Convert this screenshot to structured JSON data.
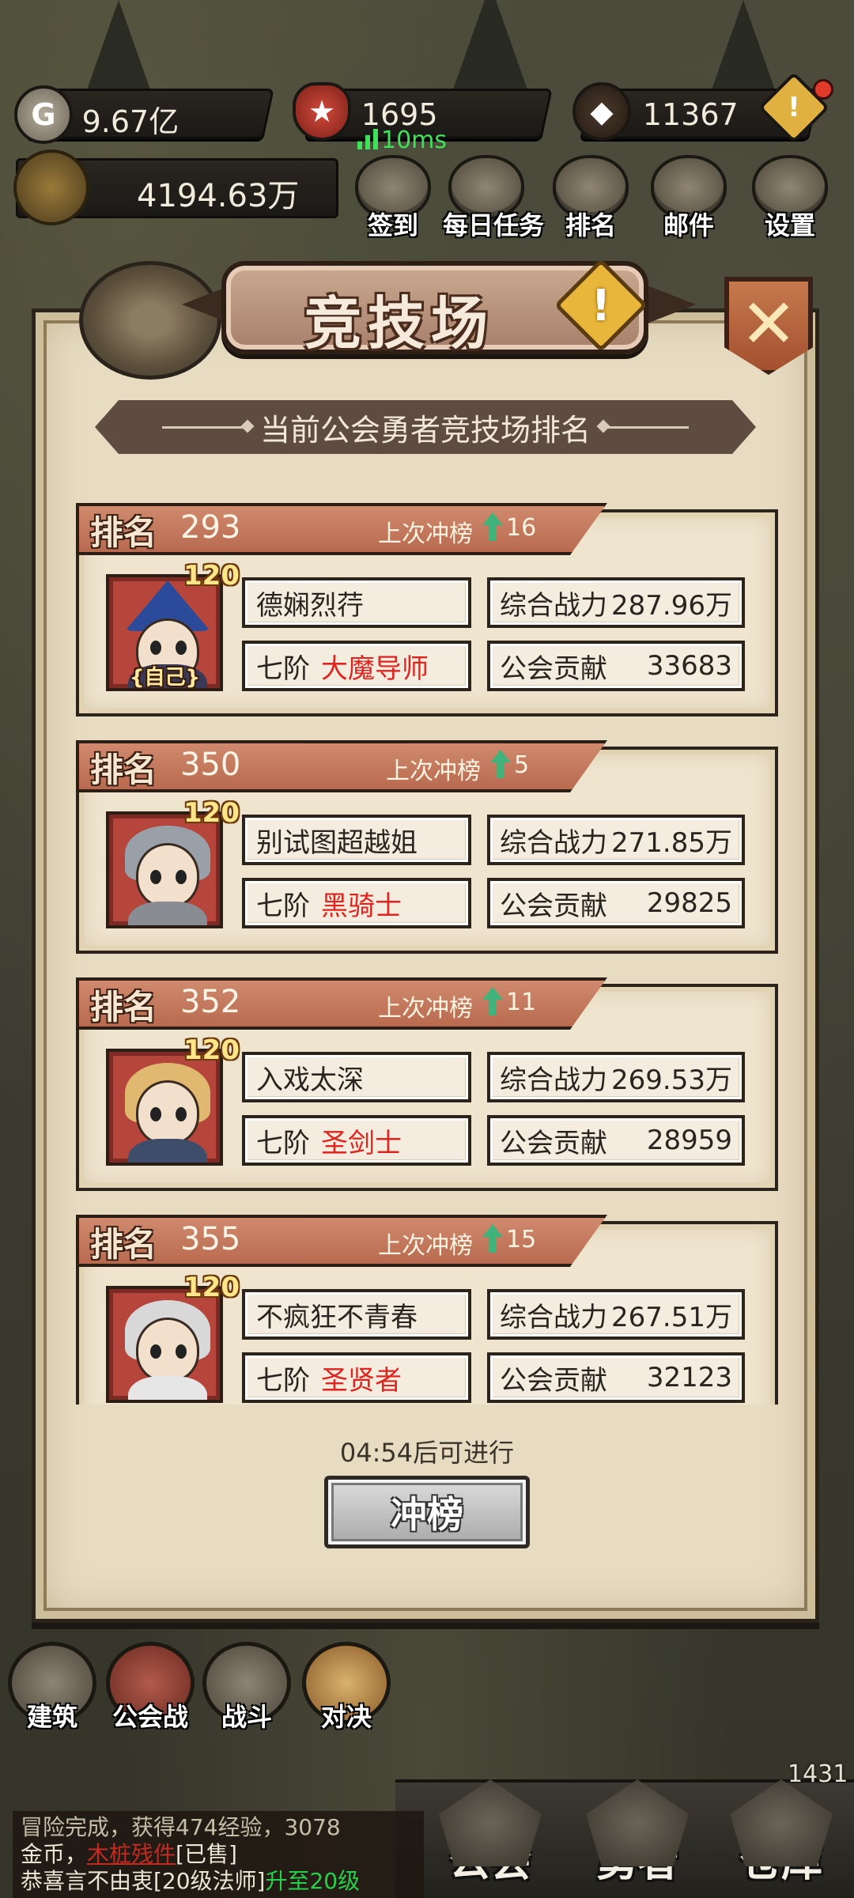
{
  "resources": {
    "gold": "9.67亿",
    "honor": "1695",
    "gems": "11367",
    "ping": "10ms",
    "power": "4194.63万"
  },
  "top_menu": [
    {
      "label": "签到",
      "icon": "signin-icon"
    },
    {
      "label": "每日任务",
      "icon": "daily-task-icon"
    },
    {
      "label": "排名",
      "icon": "ranking-icon"
    },
    {
      "label": "邮件",
      "icon": "mail-icon"
    },
    {
      "label": "设置",
      "icon": "settings-icon"
    }
  ],
  "dialog": {
    "title": "竞技场",
    "info_glyph": "!",
    "close_glyph": "✕",
    "subtitle": "当前公会勇者竞技场排名",
    "rank_label": "排名",
    "last_label": "上次冲榜",
    "level_prefix": "七阶",
    "power_label": "综合战力",
    "contrib_label": "公会贡献",
    "self_tag": "{自己}",
    "countdown": "04:54后可进行",
    "rush_button": "冲榜"
  },
  "rankings": [
    {
      "rank": "293",
      "last_change": "16",
      "name": "德娴烈荇",
      "class": "大魔导师",
      "power": "287.96万",
      "contribution": "33683",
      "level": "120",
      "is_self": true,
      "avatar": "wizard-avatar"
    },
    {
      "rank": "350",
      "last_change": "5",
      "name": "别试图超越姐",
      "class": "黑骑士",
      "power": "271.85万",
      "contribution": "29825",
      "level": "120",
      "is_self": false,
      "avatar": "knight-avatar"
    },
    {
      "rank": "352",
      "last_change": "11",
      "name": "入戏太深",
      "class": "圣剑士",
      "power": "269.53万",
      "contribution": "28959",
      "level": "120",
      "is_self": false,
      "avatar": "swordsman-avatar"
    },
    {
      "rank": "355",
      "last_change": "15",
      "name": "不疯狂不青春",
      "class": "圣贤者",
      "power": "267.51万",
      "contribution": "32123",
      "level": "120",
      "is_self": false,
      "avatar": "sage-avatar"
    }
  ],
  "bottom_menu": [
    {
      "label": "建筑"
    },
    {
      "label": "公会战"
    },
    {
      "label": "战斗"
    },
    {
      "label": "对决"
    }
  ],
  "tabs": [
    {
      "label": "公会"
    },
    {
      "label": "勇者"
    },
    {
      "label": "仓库"
    }
  ],
  "corner_number": "1431",
  "chat": {
    "line1_a": "冒险完成，获得474经验，3078",
    "line2_a": "金币，",
    "line2_item": "木桩残件",
    "line2_b": "[已售]",
    "line3_a": "恭喜言不由衷[20级法师]",
    "line3_b": "升至20级"
  },
  "colors": {
    "panel": "#e7dcc2",
    "rank_banner": "#c47a5e",
    "class_text": "#e02420",
    "up_arrow": "#3fb37a",
    "ping": "#3fe05a"
  }
}
